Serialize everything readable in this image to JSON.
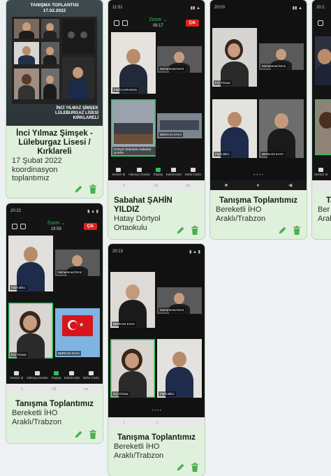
{
  "cards": [
    {
      "title": "İnci Yılmaz Şimşek - Lüleburgaz Lisesi / Kırklareli",
      "line1": "17 Şubat 2022",
      "line2": "koordinasyon",
      "line3": "toplantımız",
      "poster": {
        "head1": "TANIŞMA TOPLANTISI",
        "head2": "17.02.2022",
        "foot1": "İNCİ YILMAZ ŞİMŞEK",
        "foot2": "LÜLEBURGAZ LİSESİ",
        "foot3": "KIRKLARELİ"
      }
    },
    {
      "title": "Sabahat ŞAHİN YILDIZ",
      "line1": "Hatay Dörtyol",
      "line2": "Ortaokulu",
      "screen": {
        "time": "11:51",
        "zoom": "Zoom",
        "clock": "08:17",
        "leave": "Çık",
        "tiles": [
          "Fatih KARASAN",
          "Muhammed Emir",
          "Dörtyol Ortaokulu Sabahat ŞAHİN",
          "BERKAN KAYA"
        ],
        "bottom": [
          "Sessizi al",
          "Videoyu Durdur",
          "Paylaş",
          "Katılımcılar",
          "Daha Fazla"
        ]
      }
    },
    {
      "title": "Tanışma Toplantımız",
      "line1": "Bereketli İHO",
      "line2": "Araklı/Trabzon",
      "screen": {
        "time": "20:03",
        "tiles": [
          "İnci Yılmaz",
          "Muhammed Emir",
          "Fatih Bilici",
          "BERKAN KAYA"
        ]
      }
    },
    {
      "title": "Ta",
      "line1": "Ber",
      "line2": "Arak",
      "screen": {
        "time": "20:2",
        "bottom": [
          "Sessizi al"
        ]
      }
    },
    {
      "title": "Tanışma Toplantımız",
      "line1": "Bereketli İHO",
      "line2": "Araklı/Trabzon",
      "screen": {
        "time": "20:22",
        "zoom": "Zoom",
        "clock": "19:59",
        "leave": "Çık",
        "tiles": [
          "Fatih Bilici",
          "Muhammed Emir",
          "İnci Yılmaz",
          "BERKAN KAYA"
        ],
        "bottom": [
          "Sessizi al",
          "Videoyu Durdur",
          "Paylaş",
          "Katılımcılar",
          "Daha Fazla"
        ]
      }
    },
    {
      "title": "Tanışma Toplantımız",
      "line1": "Bereketli İHO",
      "line2": "Araklı/Trabzon",
      "screen": {
        "time": "20:13",
        "tiles": [
          "BERKAN KAYA",
          "Muhammed Emir",
          "İnci Yılmaz",
          "Fatih Bilici"
        ]
      }
    }
  ],
  "actions": {
    "edit_icon": "pencil-icon",
    "delete_icon": "trash-icon"
  },
  "colors": {
    "card_bg": "#dff1dc",
    "accent_green": "#4caf50",
    "leave_red": "#e0231c",
    "zoom_green": "#2ec15b"
  }
}
